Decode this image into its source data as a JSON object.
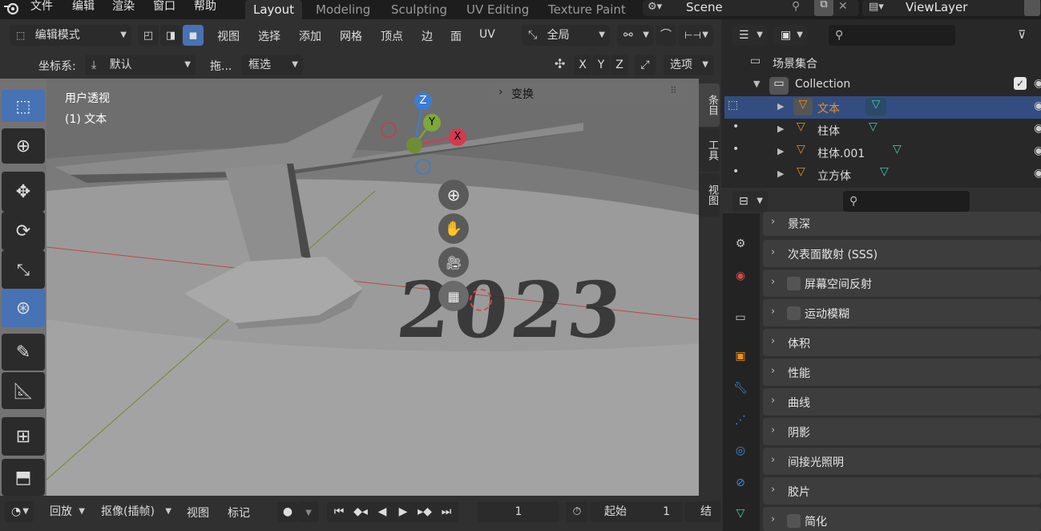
{
  "menus": [
    "文件",
    "编辑",
    "渲染",
    "窗口",
    "帮助"
  ],
  "workspaces": [
    "Layout",
    "Modeling",
    "Sculpting",
    "UV Editing",
    "Texture Paint"
  ],
  "active_workspace": "Layout",
  "scene": {
    "name": "Scene"
  },
  "view_layer": {
    "name": "ViewLayer"
  },
  "header": {
    "mode": "编辑模式",
    "menus": [
      "视图",
      "选择",
      "添加",
      "网格",
      "顶点",
      "边",
      "面",
      "UV"
    ],
    "transform_orientation": "全局",
    "coordinate_label": "坐标系:",
    "coordinate_value": "默认",
    "drag_label": "拖...",
    "drag_value": "框选",
    "axes": [
      "X",
      "Y",
      "Z"
    ],
    "options": "选项"
  },
  "viewport": {
    "view_name": "用户透视",
    "object_info": "(1) 文本",
    "transform_panel": "变换",
    "text_object": "2023",
    "gizmo": {
      "z": "Z",
      "y": "Y",
      "x": "X"
    },
    "colors": {
      "bg": "#737373",
      "floor": "#9c9c9c",
      "x_axis": "#b84a4a",
      "y_axis": "#6e8b2d"
    }
  },
  "sidebar_tabs": [
    "条目",
    "工具",
    "视图"
  ],
  "outliner": {
    "search_placeholder": "",
    "root": "场景集合",
    "collection": "Collection",
    "items": [
      {
        "name": "文本",
        "selected": true
      },
      {
        "name": "柱体",
        "selected": false
      },
      {
        "name": "柱体.001",
        "selected": false
      },
      {
        "name": "立方体",
        "selected": false
      }
    ]
  },
  "properties": {
    "sections": [
      {
        "label": "景深",
        "checkbox": false
      },
      {
        "label": "次表面散射 (SSS)",
        "checkbox": false
      },
      {
        "label": "屏幕空间反射",
        "checkbox": true
      },
      {
        "label": "运动模糊",
        "checkbox": true
      },
      {
        "label": "体积",
        "checkbox": false
      },
      {
        "label": "性能",
        "checkbox": false
      },
      {
        "label": "曲线",
        "checkbox": false
      },
      {
        "label": "阴影",
        "checkbox": false
      },
      {
        "label": "间接光照明",
        "checkbox": false
      },
      {
        "label": "胶片",
        "checkbox": false
      },
      {
        "label": "简化",
        "checkbox": true
      }
    ]
  },
  "timeline": {
    "playback": "回放",
    "keying": "抠像(插帧)",
    "view": "视图",
    "marker": "标记",
    "current_frame": "1",
    "start_label": "起始",
    "start_value": "1",
    "end_label": "结束"
  },
  "accent": "#4772b3",
  "selected_orange": "#e8902c"
}
